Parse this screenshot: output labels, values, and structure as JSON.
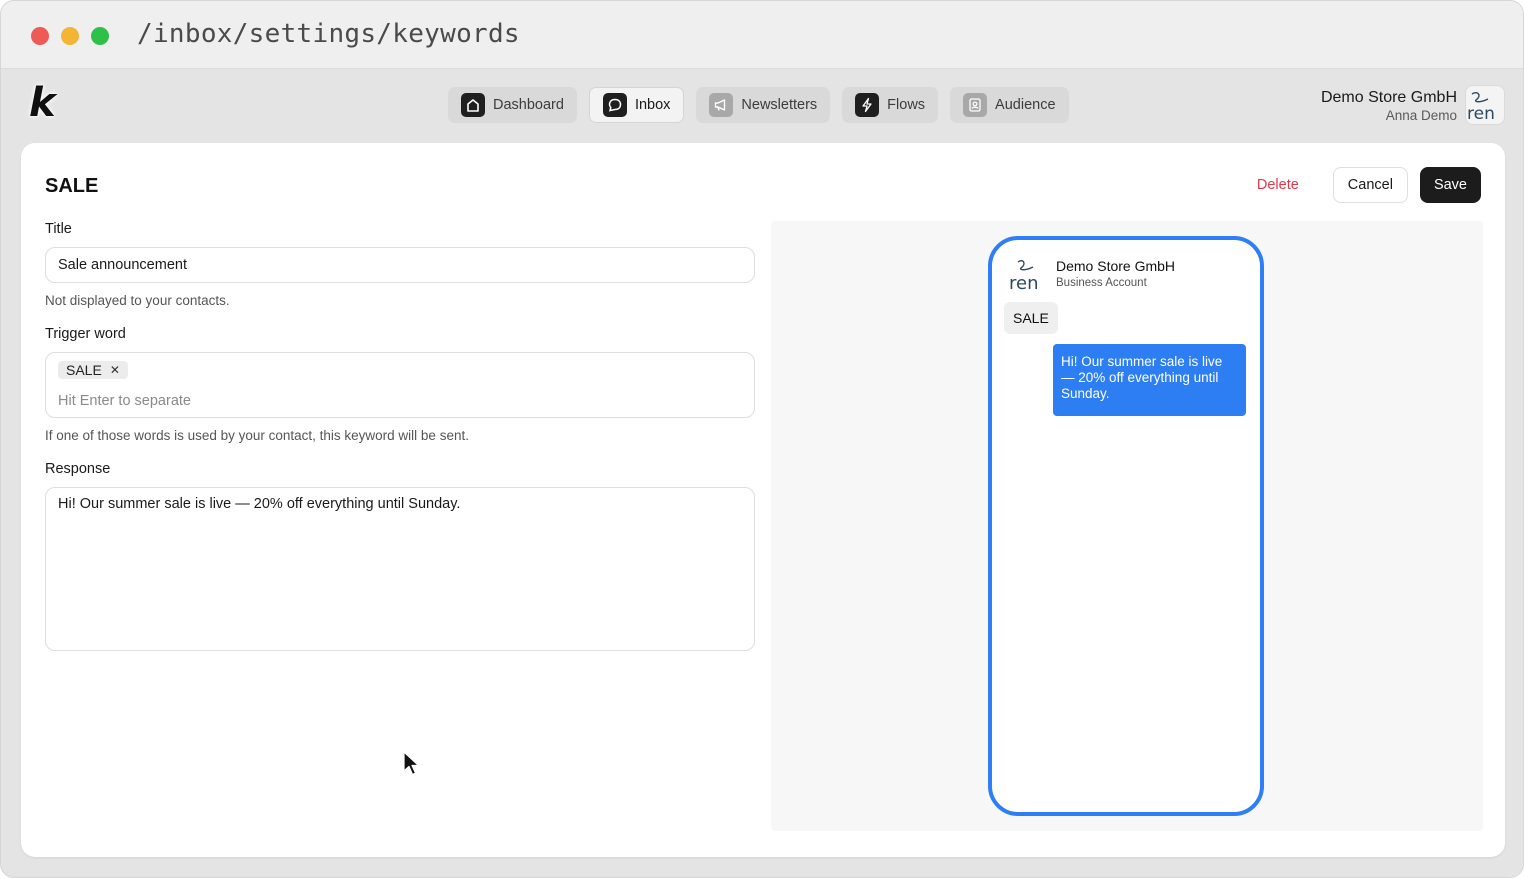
{
  "window": {
    "url": "/inbox/settings/keywords",
    "accent_color": "#2e7ef5"
  },
  "nav": {
    "logo_text": "k",
    "tabs": [
      {
        "label": "Dashboard",
        "icon": "home-icon",
        "active": false
      },
      {
        "label": "Inbox",
        "icon": "chat-bubble-icon",
        "active": true
      },
      {
        "label": "Newsletters",
        "icon": "megaphone-icon",
        "active": false
      },
      {
        "label": "Flows",
        "icon": "lightning-icon",
        "active": false
      },
      {
        "label": "Audience",
        "icon": "contact-book-icon",
        "active": false
      }
    ]
  },
  "account": {
    "store_name": "Demo Store GmbH",
    "user_name": "Anna Demo",
    "avatar_text": "ren"
  },
  "page": {
    "title": "SALE",
    "delete_label": "Delete",
    "cancel_label": "Cancel",
    "save_label": "Save",
    "delete_color": "#e0384a"
  },
  "form": {
    "title_label": "Title",
    "title_value": "Sale announcement",
    "title_hint": "Not displayed to your contacts.",
    "trigger_label": "Trigger word",
    "trigger_tags": [
      "SALE"
    ],
    "trigger_placeholder": "Hit Enter to separate",
    "trigger_hint": "If one of those words is used by your contact, this keyword will be sent.",
    "response_label": "Response",
    "response_value": "Hi! Our summer sale is live — 20% off everything until Sunday."
  },
  "preview": {
    "business_name": "Demo Store GmbH",
    "business_sub": "Business Account",
    "incoming_message": "SALE",
    "reply_message": "Hi! Our summer sale is live — 20% off everything until Sunday.",
    "bubble_color": "#2c7ef2"
  }
}
